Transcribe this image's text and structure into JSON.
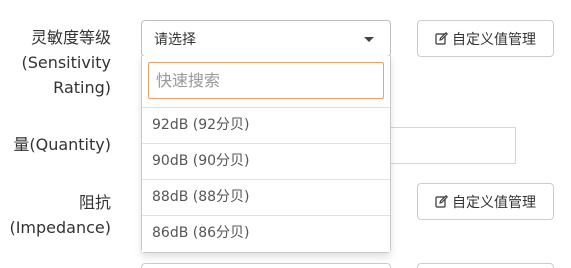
{
  "fields": {
    "sensitivity": {
      "label_line1": "灵敏度等级",
      "label_line2": "(Sensitivity",
      "label_line3": "Rating)",
      "select_value": "请选择",
      "custom_button": "自定义值管理"
    },
    "quantity": {
      "label": "量(Quantity)"
    },
    "impedance": {
      "label_line1": "阻抗",
      "label_line2": "(Impedance)",
      "custom_button": "自定义值管理"
    }
  },
  "dropdown": {
    "search_placeholder": "快速搜索",
    "options": [
      "92dB (92分贝)",
      "90dB (90分贝)",
      "88dB (88分贝)",
      "86dB (86分贝)"
    ]
  },
  "colors": {
    "search_focus_border": "#e8a36b",
    "border": "#cccccc",
    "text": "#333333"
  },
  "icons": {
    "edit": "edit-icon",
    "caret": "caret-down-icon"
  }
}
